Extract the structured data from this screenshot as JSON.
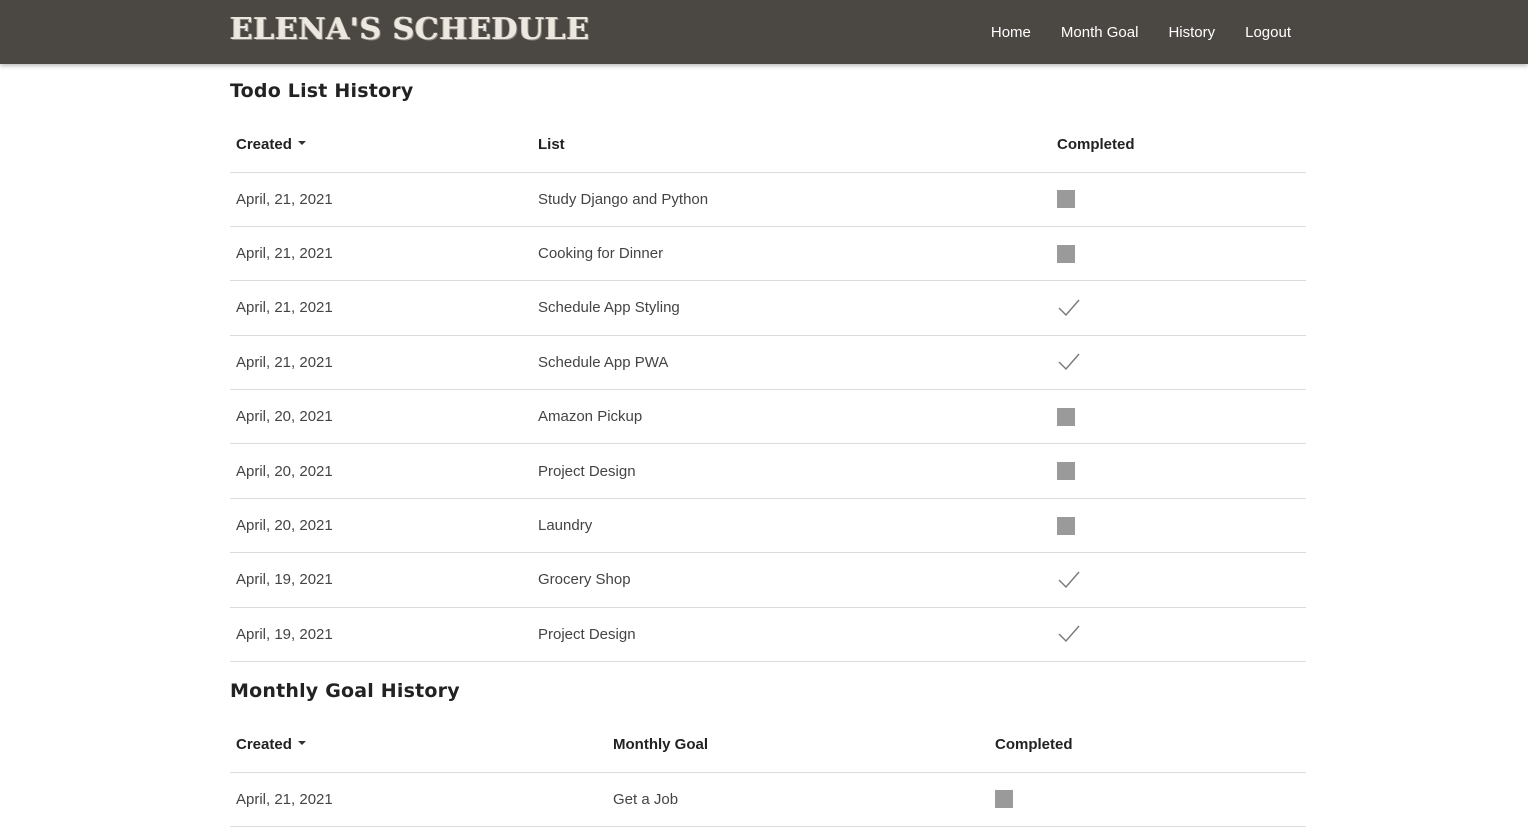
{
  "brand": "ELENA'S SCHEDULE",
  "nav": [
    "Home",
    "Month Goal",
    "History",
    "Logout"
  ],
  "todo": {
    "title": "Todo List History",
    "headers": {
      "created": "Created",
      "list": "List",
      "completed": "Completed"
    },
    "rows": [
      {
        "created": "April, 21, 2021",
        "list": "Study Django and Python",
        "completed": false
      },
      {
        "created": "April, 21, 2021",
        "list": "Cooking for Dinner",
        "completed": false
      },
      {
        "created": "April, 21, 2021",
        "list": "Schedule App Styling",
        "completed": true
      },
      {
        "created": "April, 21, 2021",
        "list": "Schedule App PWA",
        "completed": true
      },
      {
        "created": "April, 20, 2021",
        "list": "Amazon Pickup",
        "completed": false
      },
      {
        "created": "April, 20, 2021",
        "list": "Project Design",
        "completed": false
      },
      {
        "created": "April, 20, 2021",
        "list": "Laundry",
        "completed": false
      },
      {
        "created": "April, 19, 2021",
        "list": "Grocery Shop",
        "completed": true
      },
      {
        "created": "April, 19, 2021",
        "list": "Project Design",
        "completed": true
      }
    ]
  },
  "goals": {
    "title": "Monthly Goal History",
    "headers": {
      "created": "Created",
      "goal": "Monthly Goal",
      "completed": "Completed"
    },
    "rows": [
      {
        "created": "April, 21, 2021",
        "goal": "Get a Job",
        "completed": false
      }
    ]
  },
  "icons": {
    "incomplete": "square-icon",
    "complete": "checkmark-icon",
    "sort": "caret-down-icon"
  },
  "colors": {
    "navbar": "#4b4742",
    "incomplete_box": "#9a9a9a",
    "check": "#777777"
  }
}
